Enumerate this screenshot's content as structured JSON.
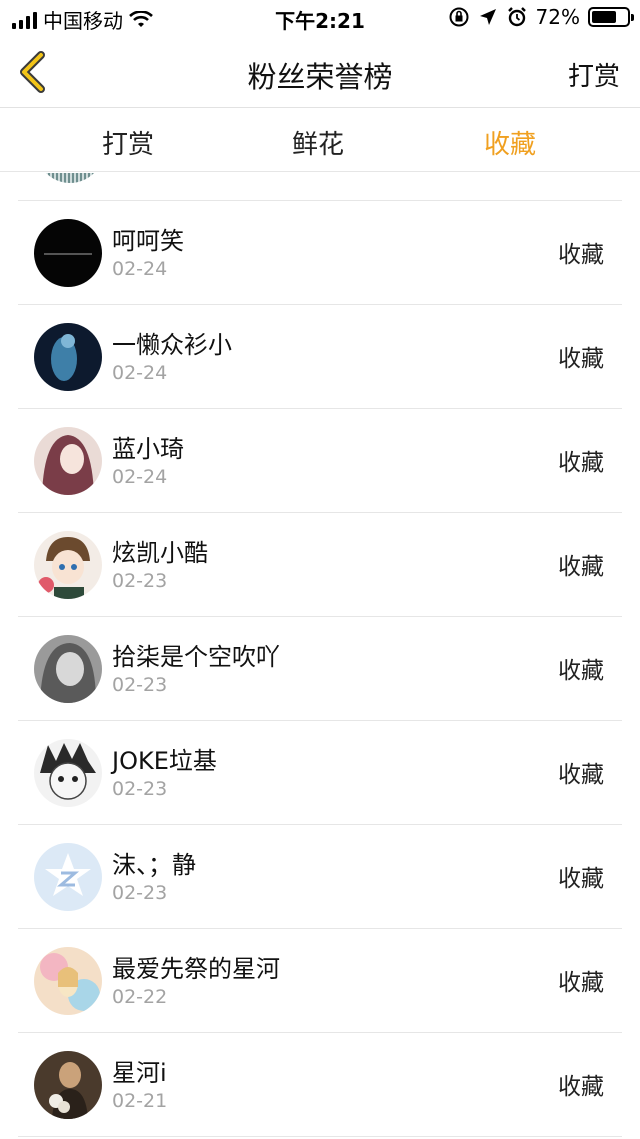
{
  "status_bar": {
    "carrier": "中国移动",
    "time": "下午2:21",
    "battery": "72%",
    "battery_level": 0.72
  },
  "nav": {
    "title": "粉丝荣誉榜",
    "action": "打赏",
    "back_icon": "chevron-left-icon",
    "accent": "#f0a020"
  },
  "tabs": [
    {
      "label": "打赏",
      "active": false
    },
    {
      "label": "鲜花",
      "active": false
    },
    {
      "label": "收藏",
      "active": true
    }
  ],
  "rows": [
    {
      "name": "呵呵笑",
      "date": "02-24",
      "action": "收藏"
    },
    {
      "name": "一懒众衫小",
      "date": "02-24",
      "action": "收藏"
    },
    {
      "name": "蓝小琦",
      "date": "02-24",
      "action": "收藏"
    },
    {
      "name": "炫凯小酷",
      "date": "02-23",
      "action": "收藏"
    },
    {
      "name": "拾柒是个空吹吖",
      "date": "02-23",
      "action": "收藏"
    },
    {
      "name": "JOKE垃基",
      "date": "02-23",
      "action": "收藏"
    },
    {
      "name": "沫、；静",
      "date": "02-23",
      "action": "收藏"
    },
    {
      "name": "最爱先祭的星河",
      "date": "02-22",
      "action": "收藏"
    },
    {
      "name": "星河i",
      "date": "02-21",
      "action": "收藏"
    }
  ]
}
